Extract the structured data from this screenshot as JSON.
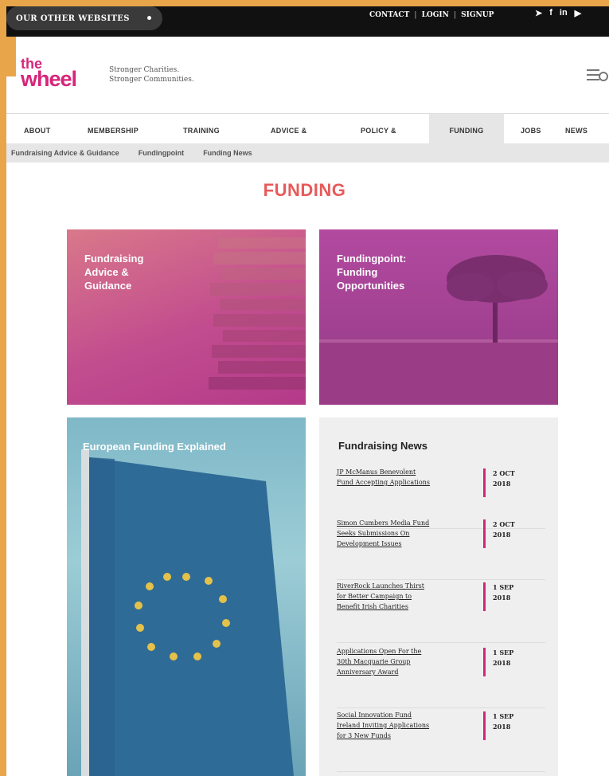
{
  "topbar": {
    "other_sites_label": "OUR OTHER WEBSITES",
    "links": [
      "CONTACT",
      "LOGIN",
      "SIGNUP"
    ],
    "socials": [
      "twitter-icon",
      "facebook-icon",
      "linkedin-icon",
      "youtube-icon"
    ]
  },
  "header": {
    "logo_the": "the",
    "logo_wheel": "wheel",
    "tagline_line1": "Stronger Charities.",
    "tagline_line2": "Stronger Communities."
  },
  "nav": {
    "items": [
      "ABOUT",
      "MEMBERSHIP",
      "TRAINING",
      "ADVICE &",
      "POLICY &",
      "FUNDING",
      "JOBS",
      "NEWS"
    ],
    "active": "FUNDING"
  },
  "subnav": {
    "items": [
      "Fundraising Advice & Guidance",
      "Fundingpoint",
      "Funding News"
    ]
  },
  "page": {
    "title": "FUNDING"
  },
  "tiles": {
    "t1_line1": "Fundraising",
    "t1_line2": "Advice &",
    "t1_line3": "Guidance",
    "t2_line1": "Fundingpoint:",
    "t2_line2": "Funding",
    "t2_line3": "Opportunities",
    "t3_title": "European Funding Explained"
  },
  "news": {
    "title": "Fundraising News",
    "items": [
      {
        "l1": "JP McManus Benevolent",
        "l2": "Fund Accepting Applications",
        "l3": "",
        "d1": "2 OCT",
        "d2": "2018"
      },
      {
        "l1": "Simon Cumbers Media Fund",
        "l2": "Seeks Submissions On",
        "l3": "Development Issues",
        "d1": "2 OCT",
        "d2": "2018"
      },
      {
        "l1": "RiverRock Launches Thirst",
        "l2": "for Better Campaign to",
        "l3": "Benefit Irish Charities",
        "d1": "1 SEP",
        "d2": "2018"
      },
      {
        "l1": "Applications Open For the",
        "l2": "30th Macquarie Group",
        "l3": "Anniversary Award",
        "d1": "1 SEP",
        "d2": "2018"
      },
      {
        "l1": "Social Innovation Fund",
        "l2": "Ireland Inviting Applications",
        "l3": "for 3 New Funds",
        "d1": "1 SEP",
        "d2": "2018"
      }
    ]
  },
  "colors": {
    "brand": "#d6257a",
    "title": "#e85a5a",
    "frame": "#e8a54a"
  }
}
